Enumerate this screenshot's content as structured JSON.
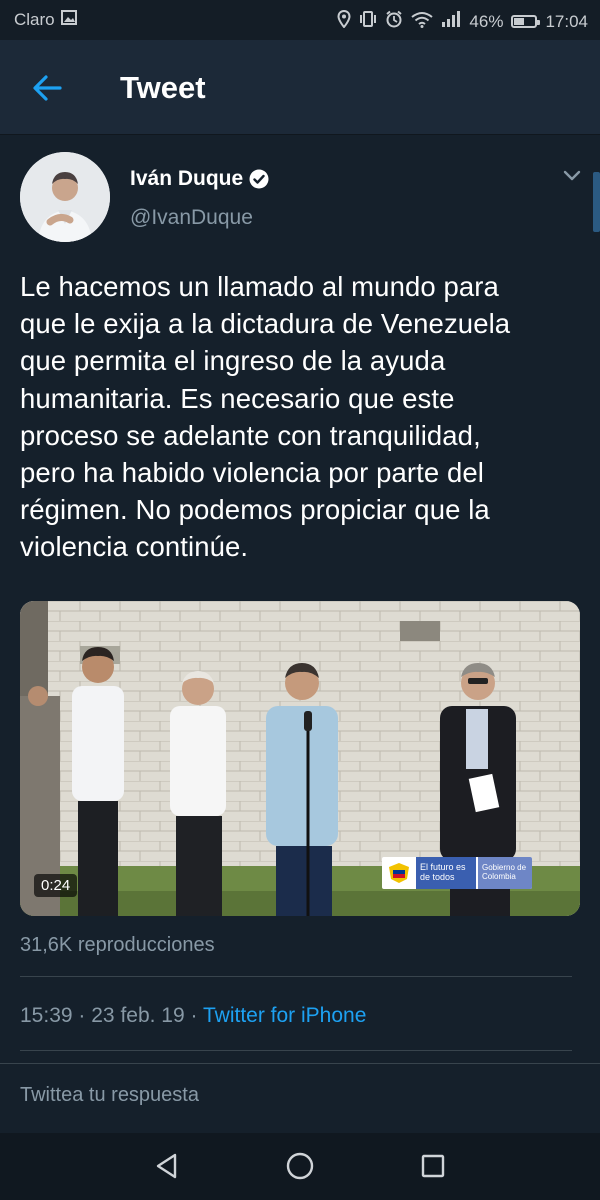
{
  "status_bar": {
    "carrier": "Claro",
    "battery": "46%",
    "time": "17:04",
    "icons": [
      "image-icon",
      "location-icon",
      "vibrate-icon",
      "alarm-icon",
      "wifi-icon",
      "signal-icon",
      "battery-icon"
    ]
  },
  "app_bar": {
    "title": "Tweet",
    "back_icon": "arrow-left-icon"
  },
  "tweet": {
    "author_name": "Iván Duque",
    "author_handle": "@IvanDuque",
    "verified": true,
    "text_lines": [
      "Le hacemos un llamado al mundo para",
      "que le exija a la dictadura de Venezuela",
      "que permita el ingreso de la ayuda",
      "humanitaria. Es necesario que este",
      "proceso se adelante con tranquilidad,",
      "pero ha habido violencia por parte del",
      "régimen. No podemos propiciar que la",
      "violencia continúe."
    ],
    "video": {
      "duration": "0:24",
      "overlay_logo": {
        "main": "El futuro es de todos",
        "sub": "Gobierno de Colombia"
      }
    },
    "views": "31,6K reproducciones",
    "time": "15:39",
    "separator": "·",
    "date": "23 feb. 19",
    "client": "Twitter for iPhone"
  },
  "reply": {
    "placeholder": "Twittea tu respuesta"
  },
  "navigation": [
    "back-icon",
    "home-icon",
    "recents-icon"
  ],
  "colors": {
    "background": "#15202b",
    "accent": "#1da1f2",
    "secondary_text": "#8899a6"
  }
}
